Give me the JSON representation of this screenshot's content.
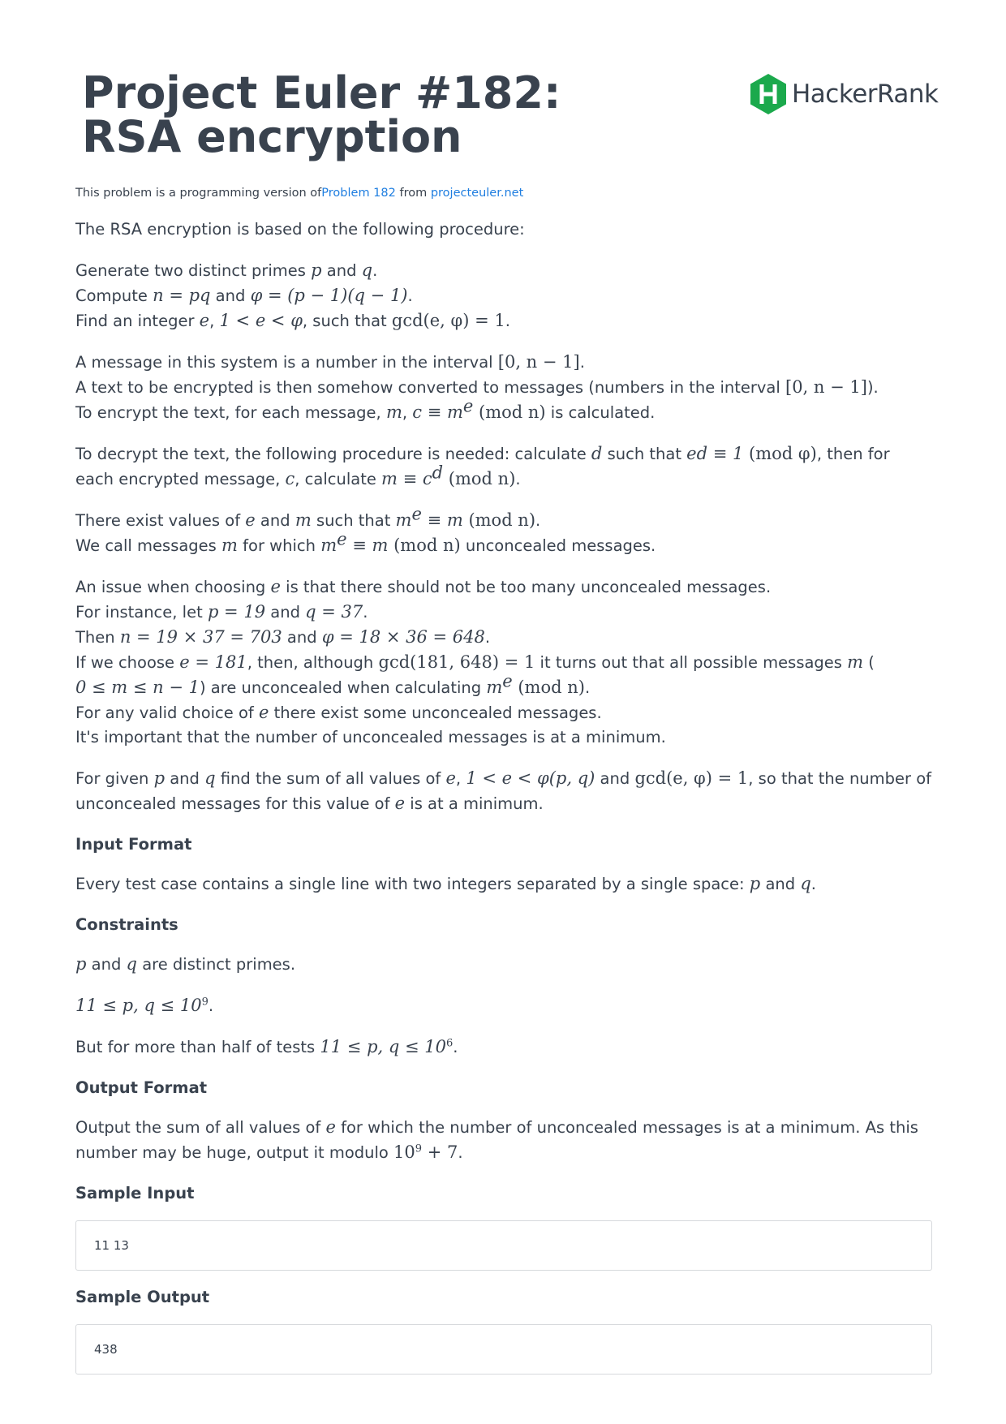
{
  "header": {
    "title_line1": "Project Euler #182:",
    "title_line2": "RSA encryption",
    "logo_text": "HackerRank",
    "logo_color": "#1ba94c"
  },
  "source": {
    "prefix": "This problem is a programming version of",
    "problem_link": "Problem 182",
    "mid": " from ",
    "site_link": "projecteuler.net",
    "link_color": "#1f7ee0"
  },
  "body": {
    "intro": "The RSA encryption is based on the following procedure:",
    "gen_a": "Generate two distinct primes ",
    "gen_b": " and ",
    "gen_c": ".",
    "comp_a": "Compute ",
    "comp_m1": "n = pq",
    "comp_b": " and ",
    "comp_m2": "φ = (p − 1)(q − 1)",
    "comp_c": ".",
    "find_a": "Find an integer ",
    "find_b": ", ",
    "find_m1": "1 < e < φ",
    "find_c": ", such that ",
    "find_m2": "gcd(e, φ) = 1",
    "find_d": ".",
    "msg_a": "A message in this system is a number in the interval ",
    "msg_m": "[0, n − 1]",
    "msg_b": ".",
    "txt_a": "A text to be encrypted is then somehow converted to messages (numbers in the interval ",
    "txt_m": "[0, n − 1]",
    "txt_b": ").",
    "enc_a": "To encrypt the text, for each message, ",
    "enc_b": ", ",
    "enc_m": "c ≡ m",
    "enc_mod": "  (mod  n)",
    "enc_c": " is calculated.",
    "dec_a": "To decrypt the text, the following procedure is needed: calculate ",
    "dec_b": " such that ",
    "dec_m1": "ed ≡ 1",
    "dec_mod1": "  (mod  φ)",
    "dec_c": ", then for each encrypted message, ",
    "dec_d": ", calculate ",
    "dec_m2": "m ≡ c",
    "dec_mod2": "  (mod  n)",
    "dec_e": ".",
    "ex_a": "There exist values of ",
    "ex_b": " and ",
    "ex_c": " such that ",
    "ex_m": "m",
    "ex_m2": " ≡ m",
    "ex_mod": "  (mod  n)",
    "ex_d": ".",
    "call_a": "We call messages ",
    "call_b": " for which ",
    "call_mod": "  (mod  n)",
    "call_c": " unconcealed messages.",
    "iss_a": "An issue when choosing ",
    "iss_b": " is that there should not be too many unconcealed messages.",
    "inst_a": "For instance, let ",
    "inst_m1": "p = 19",
    "inst_b": " and ",
    "inst_m2": "q = 37",
    "inst_c": ".",
    "then_a": "Then ",
    "then_m1": "n = 19 × 37 = 703",
    "then_b": " and ",
    "then_m2": "φ = 18 × 36 = 648",
    "then_c": ".",
    "if_a": "If we choose ",
    "if_m1": "e = 181",
    "if_b": ", then, although ",
    "if_m2": "gcd(181, 648) = 1",
    "if_c": " it turns out that all possible messages ",
    "if_d": " (",
    "if_m3": "0 ≤ m ≤ n − 1",
    "if_e": ") are unconcealed when calculating ",
    "if_mod": "  (mod  n)",
    "if_f": ".",
    "any_a": "For any valid choice of ",
    "any_b": " there exist some unconcealed messages.",
    "imp": "It's important that the number of unconcealed messages is at a minimum.",
    "given_a": "For given ",
    "given_b": " and ",
    "given_c": " find the sum of all values of ",
    "given_d": ", ",
    "given_m1": "1 < e < φ(p, q)",
    "given_e": " and ",
    "given_m2": "gcd(e, φ) = 1",
    "given_f": ", so that the number of unconcealed messages for this value of ",
    "given_g": " is at a minimum.",
    "input_heading": "Input Format",
    "input_a": "Every test case contains a single line with two integers separated by a single space: ",
    "input_b": " and ",
    "input_c": ".",
    "constraints_heading": "Constraints",
    "c1_b": " and ",
    "c1_c": " are distinct primes.",
    "c2_m": "11 ≤ p, q ≤ 10",
    "c2_exp": "9",
    "c2_b": ".",
    "c3_a": "But for more than half of tests ",
    "c3_m": "11 ≤ p, q ≤ 10",
    "c3_exp": "6",
    "c3_b": ".",
    "output_heading": "Output Format",
    "out_a": "Output the sum of all values of ",
    "out_b": " for which the number of unconcealed messages is at a minimum. As this number may be huge, output it modulo ",
    "out_m": "10",
    "out_exp": "9",
    "out_m2": " + 7",
    "out_c": ".",
    "sample_input_heading": "Sample Input",
    "sample_input": "11 13",
    "sample_output_heading": "Sample Output",
    "sample_output": "438"
  },
  "vars": {
    "p": "p",
    "q": "q",
    "e": "e",
    "m": "m",
    "c": "c",
    "d": "d",
    "n": "n"
  }
}
